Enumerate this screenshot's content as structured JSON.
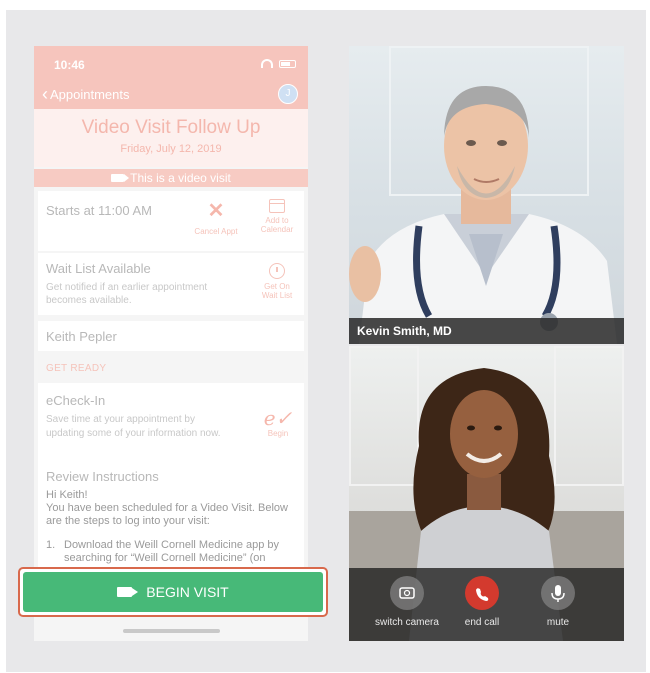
{
  "phone": {
    "status_time": "10:46",
    "nav_back": "Appointments",
    "avatar_initial": "J",
    "title": "Video Visit Follow Up",
    "date": "Friday, July 12, 2019",
    "video_banner": "This is a video visit",
    "starts": "Starts at 11:00 AM",
    "cancel_line": "Cancel Appt",
    "add_cal_1": "Add to",
    "add_cal_2": "Calendar",
    "wait_title": "Wait List Available",
    "wait_desc": "Get notified if an earlier appointment becomes available.",
    "get_on_1": "Get On",
    "get_on_2": "Wait List",
    "patient": "Keith Pepler",
    "section": "GET READY",
    "echeck_title": "eCheck-In",
    "echeck_desc": "Save time at your appointment by updating some of your information now.",
    "echeck_begin": "Begin",
    "review_title": "Review Instructions",
    "review_greeting": "Hi Keith!",
    "review_body": "You have been scheduled for a Video Visit. Below are the steps to log into your visit:",
    "step_num": "1.",
    "step_text": "Download the Weill Cornell Medicine app by searching for “Weill Cornell Medicine” (on",
    "begin_visit": "BEGIN VISIT"
  },
  "video": {
    "doctor_name": "Kevin Smith, MD",
    "controls": [
      {
        "label": "switch camera",
        "icon": "switch-camera-icon"
      },
      {
        "label": "end call",
        "icon": "end-call-icon"
      },
      {
        "label": "mute",
        "icon": "microphone-icon"
      }
    ]
  },
  "colors": {
    "accent_pink": "#f6c5bd",
    "begin_green": "#47b978",
    "highlight_border": "#d8694c",
    "end_call_red": "#d33a2e"
  }
}
